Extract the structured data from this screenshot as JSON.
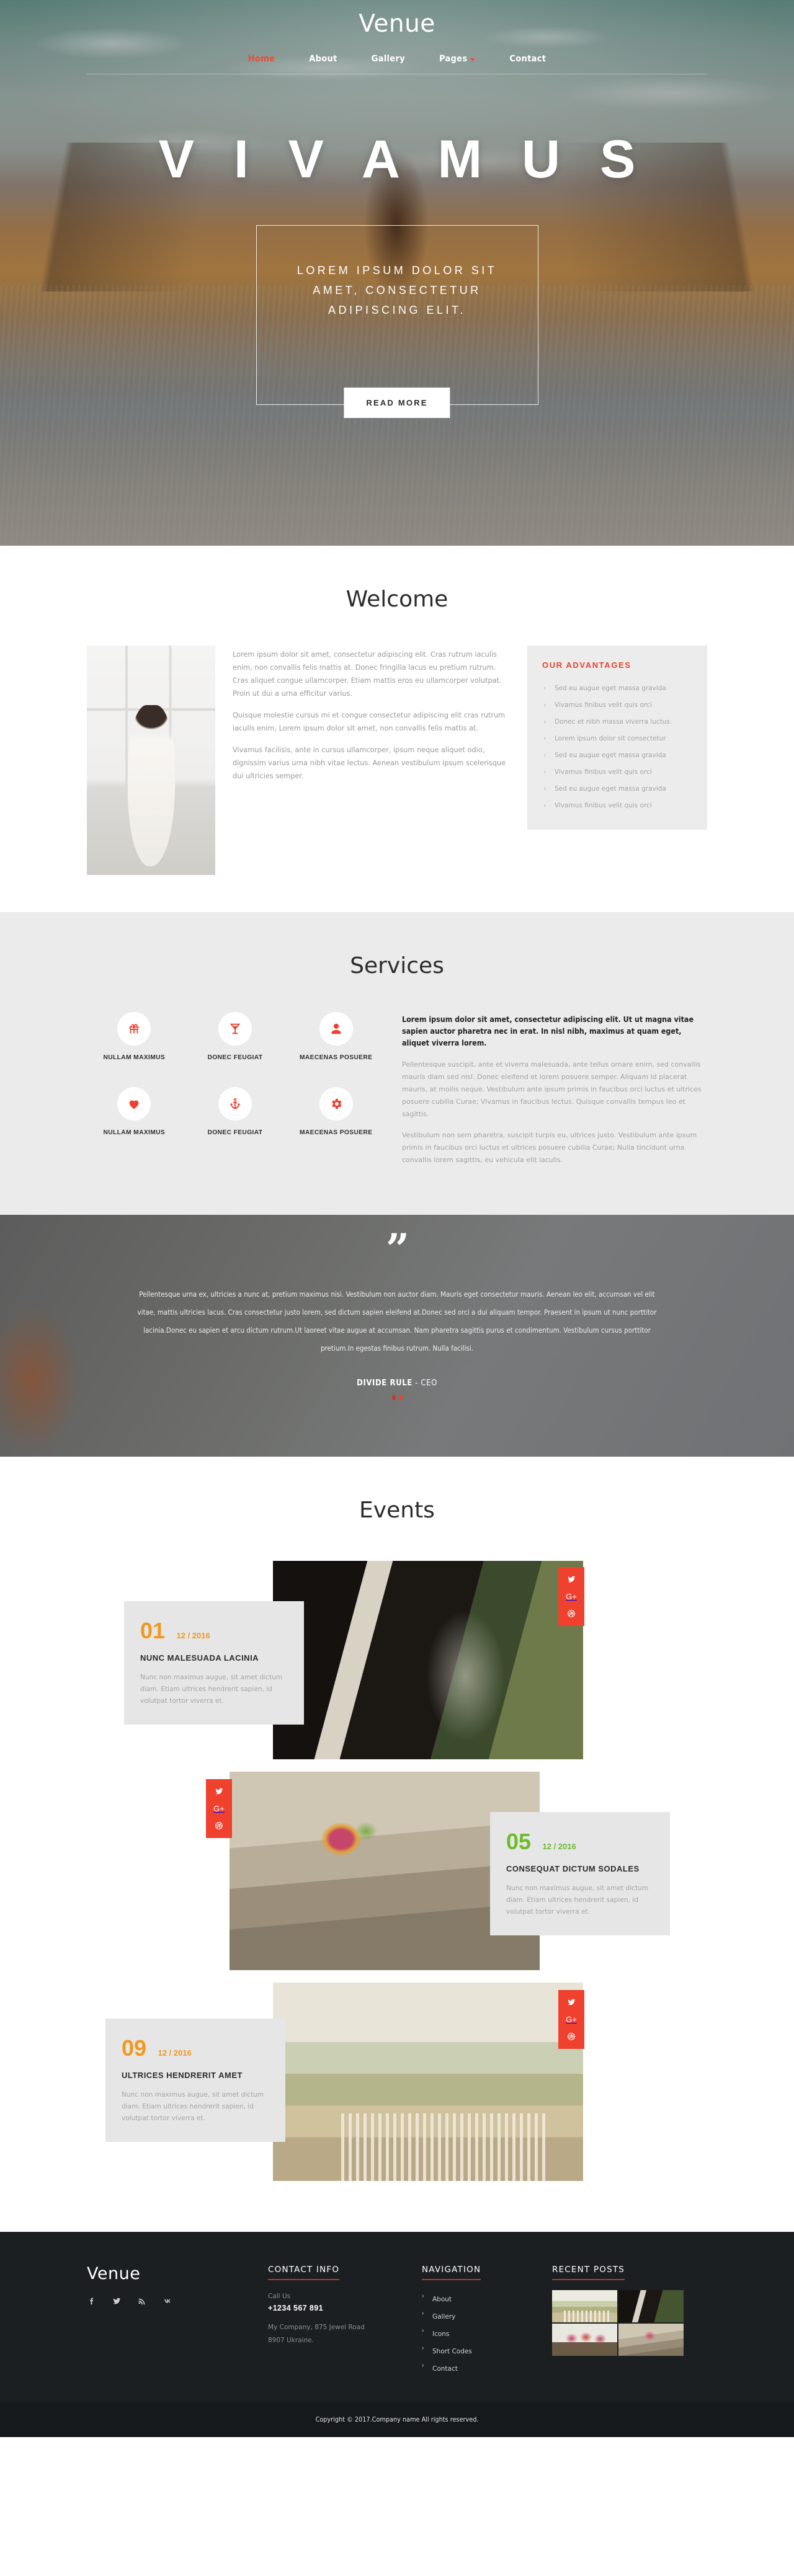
{
  "brand": "Venue",
  "nav": {
    "items": [
      {
        "label": "Home",
        "active": true,
        "caret": false
      },
      {
        "label": "About",
        "active": false,
        "caret": false
      },
      {
        "label": "Gallery",
        "active": false,
        "caret": false
      },
      {
        "label": "Pages",
        "active": false,
        "caret": true
      },
      {
        "label": "Contact",
        "active": false,
        "caret": false
      }
    ]
  },
  "hero": {
    "title": "V I V A M U S",
    "subtitle": "LOREM IPSUM DOLOR SIT AMET, CONSECTETUR ADIPISCING ELIT.",
    "button": "READ MORE"
  },
  "welcome": {
    "title": "Welcome",
    "paragraphs": [
      "Lorem ipsum dolor sit amet, consectetur adipiscing elit. Cras rutrum iaculis enim, non convallis felis mattis at. Donec fringilla lacus eu pretium rutrum. Cras aliquet congue ullamcorper. Etiam mattis eros eu ullamcorper volutpat. Proin ut dui a urna efficitur varius.",
      "Quisque molestie cursus mi et congue consectetur adipiscing elit cras rutrum iaculis enim, Lorem ipsum dolor sit amet, non convallis felis mattis at.",
      "Vivamus facilisis, ante in cursus ullamcorper, ipsum neque aliquet odio, dignissim varius urna nibh vitae lectus. Aenean vestibulum ipsum scelerisque dui ultricies semper."
    ],
    "advantages_title": "OUR ADVANTAGES",
    "advantages": [
      "Sed eu augue eget massa gravida",
      "Vivamus finibus velit quis orci",
      "Donec et nibh massa viverra luctus.",
      "Lorem ipsum dolor sit consectetur",
      "Sed eu augue eget massa gravida",
      "Vivamus finibus velit quis orci",
      "Sed eu augue eget massa gravida",
      "Vivamus finibus velit quis orci"
    ]
  },
  "services": {
    "title": "Services",
    "items": [
      {
        "icon": "gift-icon",
        "label": "NULLAM MAXIMUS"
      },
      {
        "icon": "cocktail-icon",
        "label": "DONEC FEUGIAT"
      },
      {
        "icon": "user-icon",
        "label": "MAECENAS POSUERE"
      },
      {
        "icon": "heart-icon",
        "label": "NULLAM MAXIMUS"
      },
      {
        "icon": "anchor-icon",
        "label": "DONEC FEUGIAT"
      },
      {
        "icon": "gear-icon",
        "label": "MAECENAS POSUERE"
      }
    ],
    "lead": "Lorem ipsum dolor sit amet, consectetur adipiscing elit. Ut ut magna vitae sapien auctor pharetra nec in erat. In nisl nibh, maximus at quam eget, aliquet viverra lorem.",
    "paragraphs": [
      "Pellentesque suscipit, ante et viverra malesuada, ante tellus ornare enim, sed convallis mauris diam sed nisl. Donec eleifend et lorem posuere semper. Aliquam id placerat mauris, at mollis neque. Vestibulum ante ipsum primis in faucibus orci luctus et ultrices posuere cubilia Curae; Vivamus in faucibus lectus. Quisque convallis tempus leo et sagittis.",
      "Vestibulum non sem pharetra, suscipit turpis eu, ultrices justo. Vestibulum ante ipsum primis in faucibus orci luctus et ultrices posuere cubilia Curae; Nulla tincidunt urna convallis lorem sagittis, eu vehicula elit iaculis."
    ]
  },
  "testimonial": {
    "quote_glyph": "”",
    "text": "Pellentesque urna ex, ultricies a nunc at, pretium maximus nisi. Vestibulum non auctor diam. Mauris eget consectetur mauris. Aenean leo elit, accumsan vel elit vitae, mattis ultricies lacus. Cras consectetur justo lorem, sed dictum sapien eleifend at.Donec sed orci a dui aliquam tempor. Praesent in ipsum ut nunc porttitor lacinia.Donec eu sapien et arcu dictum rutrum.Ut laoreet vitae augue at accumsan. Nam pharetra sagittis purus et condimentum. Vestibulum cursus porttitor pretium.In egestas finibus rutrum. Nulla facilisi.",
    "author_name": "DIVIDE RULE",
    "author_role": "- CEO"
  },
  "events": {
    "title": "Events",
    "share_icons": [
      "twitter-icon",
      "google-plus-icon",
      "dribbble-icon"
    ],
    "items": [
      {
        "num": "01",
        "date": "12 / 2016",
        "accent": "#f0991e",
        "title": "NUNC MALESUADA LACINIA",
        "desc": "Nunc non maximus augue, sit amet dictum diam. Etiam ultrices hendrerit sapien, id volutpat tortor viverra et."
      },
      {
        "num": "05",
        "date": "12 / 2016",
        "accent": "#6fbb2c",
        "title": "CONSEQUAT DICTUM SODALES",
        "desc": "Nunc non maximus augue, sit amet dictum diam. Etiam ultrices hendrerit sapien, id volutpat tortor viverra et."
      },
      {
        "num": "09",
        "date": "12 / 2016",
        "accent": "#f0991e",
        "title": "ULTRICES HENDRERIT AMET",
        "desc": "Nunc non maximus augue, sit amet dictum diam. Etiam ultrices hendrerit sapien, id volutpat tortor viverra et."
      }
    ]
  },
  "footer": {
    "brand": "Venue",
    "social": [
      "facebook-icon",
      "twitter-icon",
      "rss-icon",
      "vk-icon"
    ],
    "contact_heading": "CONTACT INFO",
    "call_label": "Call Us",
    "phone": "+1234 567 891",
    "address_line1": "My Company, 875 Jewel Road",
    "address_line2": "8907 Ukraine.",
    "nav_heading": "NAVIGATION",
    "nav_items": [
      "About",
      "Gallery",
      "Icons",
      "Short Codes",
      "Contact"
    ],
    "posts_heading": "RECENT POSTS",
    "copyright": "Copyright © 2017.Company name All rights reserved."
  },
  "colors": {
    "accent_red": "#f0412f",
    "accent_orange": "#f0991e",
    "accent_green": "#6fbb2c",
    "footer_bg": "#1b1f21"
  }
}
